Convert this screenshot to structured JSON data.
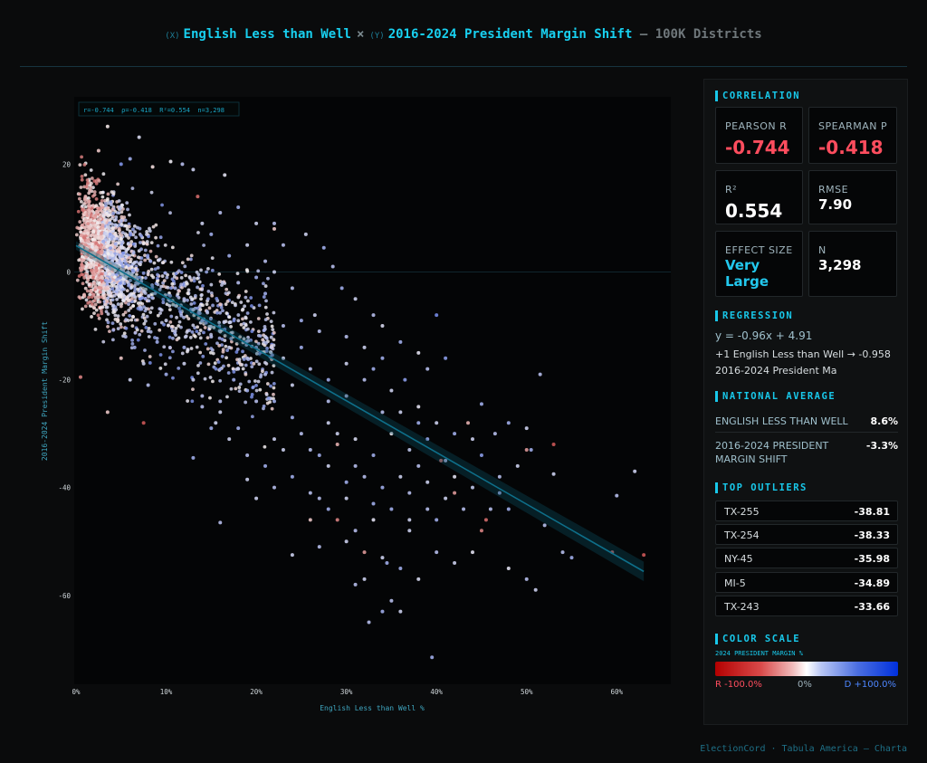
{
  "header": {
    "x_tag": "(X)",
    "x_var": "English Less than Well",
    "times": "×",
    "y_tag": "(Y)",
    "y_var": "2016-2024 President Margin Shift",
    "suffix": "— 100K Districts"
  },
  "chart_data": {
    "type": "scatter",
    "stats_box": "r=-0.744  ρ=-0.418  R²=0.554  n=3,298",
    "xlabel": "English Less than Well %",
    "ylabel": "2016-2024 President Margin Shift",
    "xlim": [
      -0.2,
      66
    ],
    "ylim": [
      -76.5,
      32.5
    ],
    "x_ticks": [
      {
        "v": 0,
        "label": "0%"
      },
      {
        "v": 10,
        "label": "10%"
      },
      {
        "v": 20,
        "label": "20%"
      },
      {
        "v": 30,
        "label": "30%"
      },
      {
        "v": 40,
        "label": "40%"
      },
      {
        "v": 50,
        "label": "50%"
      },
      {
        "v": 60,
        "label": "60%"
      }
    ],
    "y_ticks": [
      {
        "v": 20,
        "label": "20"
      },
      {
        "v": 0,
        "label": "0"
      },
      {
        "v": -20,
        "label": "-20"
      },
      {
        "v": -40,
        "label": "-40"
      },
      {
        "v": -60,
        "label": "-60"
      }
    ],
    "regression": {
      "slope": -0.96,
      "intercept": 4.91,
      "x_range": [
        0,
        63
      ]
    },
    "n": 3298,
    "points": [
      [
        3.5,
        27,
        -5
      ],
      [
        7,
        25,
        15
      ],
      [
        2.5,
        22.5,
        -20
      ],
      [
        10.5,
        20.5,
        5
      ],
      [
        11.8,
        20,
        30
      ],
      [
        13.5,
        14,
        -60
      ],
      [
        16.5,
        18,
        10
      ],
      [
        13,
        19,
        20
      ],
      [
        8.5,
        19.5,
        -10
      ],
      [
        6,
        21,
        40
      ],
      [
        5,
        20,
        55
      ],
      [
        22,
        9,
        30
      ],
      [
        25.5,
        7,
        20
      ],
      [
        27.5,
        4.5,
        40
      ],
      [
        28.5,
        1,
        30
      ],
      [
        29.5,
        -3,
        40
      ],
      [
        31,
        -5,
        20
      ],
      [
        33,
        -8,
        30
      ],
      [
        34,
        -10,
        15
      ],
      [
        36,
        -13,
        40
      ],
      [
        38,
        -15,
        10
      ],
      [
        39,
        -18,
        30
      ],
      [
        41,
        -16,
        50
      ],
      [
        40,
        -8,
        60
      ],
      [
        33,
        -18,
        40
      ],
      [
        35,
        -22,
        20
      ],
      [
        36.5,
        -20,
        50
      ],
      [
        38,
        -25,
        10
      ],
      [
        30,
        -23,
        30
      ],
      [
        28,
        -28,
        20
      ],
      [
        31,
        -31,
        15
      ],
      [
        33,
        -34,
        40
      ],
      [
        35,
        -30,
        5
      ],
      [
        37,
        -33,
        25
      ],
      [
        39,
        -31,
        45
      ],
      [
        41,
        -35,
        30
      ],
      [
        42,
        -38,
        10
      ],
      [
        44,
        -40,
        25
      ],
      [
        46,
        -44,
        30
      ],
      [
        48,
        -44,
        40
      ],
      [
        45,
        -48,
        -50
      ],
      [
        42,
        -41,
        -40
      ],
      [
        40.5,
        -35,
        -60
      ],
      [
        39,
        -39,
        20
      ],
      [
        37,
        -41,
        30
      ],
      [
        35,
        -44,
        40
      ],
      [
        33,
        -46,
        10
      ],
      [
        31,
        -48,
        30
      ],
      [
        29,
        -46,
        -50
      ],
      [
        30,
        -50,
        20
      ],
      [
        32,
        -52,
        -40
      ],
      [
        34,
        -53,
        20
      ],
      [
        36,
        -55,
        40
      ],
      [
        38,
        -57,
        15
      ],
      [
        40,
        -52,
        30
      ],
      [
        42,
        -54,
        20
      ],
      [
        44,
        -52,
        10
      ],
      [
        45.5,
        -46,
        -60
      ],
      [
        48,
        -28,
        40
      ],
      [
        50,
        -29,
        20
      ],
      [
        51.5,
        -19,
        30
      ],
      [
        53,
        -32,
        -70
      ],
      [
        50,
        -33,
        -40
      ],
      [
        50.5,
        -33,
        40
      ],
      [
        53,
        -37.5,
        20
      ],
      [
        54,
        -52,
        30
      ],
      [
        55,
        -53,
        40
      ],
      [
        52,
        -47,
        30
      ],
      [
        51,
        -59,
        20
      ],
      [
        50,
        -57,
        30
      ],
      [
        48,
        -55,
        10
      ],
      [
        43.5,
        -28,
        -30
      ],
      [
        44,
        -31,
        20
      ],
      [
        45,
        -24.5,
        40
      ],
      [
        47,
        -38,
        30
      ],
      [
        45,
        -34,
        50
      ],
      [
        46.5,
        -30,
        30
      ],
      [
        40,
        -46,
        40
      ],
      [
        37,
        -48,
        20
      ],
      [
        35,
        -61,
        30
      ],
      [
        36,
        -63,
        20
      ],
      [
        34,
        -63,
        40
      ],
      [
        32.5,
        -65,
        30
      ],
      [
        39.5,
        -71.5,
        40
      ],
      [
        60,
        -41.5,
        30
      ],
      [
        62,
        -37,
        20
      ],
      [
        59.5,
        -52,
        -60
      ],
      [
        63,
        -52.5,
        -70
      ],
      [
        16,
        -46.5,
        30
      ],
      [
        19,
        -38.5,
        20
      ],
      [
        13,
        -34.5,
        40
      ],
      [
        31,
        -58,
        30
      ],
      [
        32,
        -57,
        20
      ],
      [
        34.5,
        -54,
        40
      ],
      [
        27,
        -51,
        30
      ],
      [
        24,
        -52.5,
        20
      ],
      [
        26,
        -46,
        -20
      ],
      [
        12,
        -17,
        20
      ],
      [
        14,
        -23,
        30
      ],
      [
        16,
        -26,
        20
      ],
      [
        18,
        -29,
        40
      ],
      [
        20,
        -24,
        30
      ],
      [
        22,
        -31,
        20
      ],
      [
        24,
        -27,
        40
      ],
      [
        26,
        -33,
        30
      ],
      [
        28,
        -36,
        20
      ],
      [
        30,
        -39,
        40
      ],
      [
        22,
        -40,
        30
      ],
      [
        20,
        -42,
        20
      ],
      [
        24,
        -38,
        40
      ],
      [
        27,
        -42,
        30
      ],
      [
        29,
        -32,
        -30
      ],
      [
        0.5,
        -19.5,
        -50
      ],
      [
        7.5,
        -28,
        -70
      ],
      [
        3.5,
        -26,
        -20
      ],
      [
        15.5,
        -28,
        20
      ],
      [
        16,
        -24,
        30
      ],
      [
        17.5,
        -20,
        40
      ],
      [
        18,
        -18,
        20
      ],
      [
        19,
        -16,
        30
      ],
      [
        20,
        -14,
        40
      ],
      [
        21,
        -12,
        20
      ],
      [
        23,
        -10,
        30
      ],
      [
        25,
        -9,
        40
      ],
      [
        26.5,
        -8,
        20
      ],
      [
        27,
        -11,
        30
      ],
      [
        25,
        -14,
        40
      ],
      [
        23,
        -16,
        20
      ],
      [
        21,
        -19,
        30
      ],
      [
        19,
        -22,
        40
      ],
      [
        17,
        -14,
        20
      ],
      [
        15,
        -12,
        30
      ],
      [
        14,
        -9,
        40
      ],
      [
        13,
        -7,
        20
      ],
      [
        12,
        -5,
        30
      ],
      [
        11,
        -3,
        40
      ],
      [
        16,
        -6,
        -20
      ],
      [
        18,
        -2,
        30
      ],
      [
        20,
        -1,
        40
      ],
      [
        22,
        0,
        20
      ],
      [
        24,
        -3,
        30
      ],
      [
        17,
        3,
        40
      ],
      [
        19,
        5,
        20
      ],
      [
        21,
        2,
        30
      ],
      [
        15,
        7,
        40
      ],
      [
        14,
        9,
        20
      ],
      [
        16,
        11,
        30
      ],
      [
        18,
        12,
        40
      ],
      [
        20,
        9,
        20
      ],
      [
        23,
        5,
        30
      ],
      [
        22,
        8,
        -20
      ],
      [
        21,
        -4,
        40
      ],
      [
        30,
        -12,
        30
      ],
      [
        32,
        -14,
        20
      ],
      [
        34,
        -16,
        40
      ],
      [
        32,
        -20,
        30
      ],
      [
        30,
        -17,
        20
      ],
      [
        28,
        -20,
        40
      ],
      [
        26,
        -18,
        30
      ],
      [
        24,
        -21,
        20
      ],
      [
        22,
        -24,
        40
      ],
      [
        28,
        -24,
        30
      ],
      [
        36,
        -26,
        20
      ],
      [
        38,
        -28,
        40
      ],
      [
        34,
        -26,
        30
      ],
      [
        40,
        -28,
        20
      ],
      [
        42,
        -30,
        40
      ],
      [
        38,
        -36,
        30
      ],
      [
        36,
        -38,
        20
      ],
      [
        34,
        -40,
        40
      ],
      [
        32,
        -38,
        30
      ],
      [
        30,
        -42,
        20
      ],
      [
        28,
        -44,
        40
      ],
      [
        26,
        -41,
        30
      ],
      [
        41,
        -42,
        20
      ],
      [
        43,
        -44,
        30
      ],
      [
        47,
        -41,
        40
      ],
      [
        49,
        -36,
        20
      ],
      [
        39,
        -44,
        30
      ],
      [
        37,
        -46,
        20
      ],
      [
        33,
        -43,
        40
      ],
      [
        31,
        -36,
        30
      ],
      [
        29,
        -30,
        20
      ],
      [
        27,
        -34,
        40
      ],
      [
        25,
        -30,
        30
      ],
      [
        23,
        -33,
        20
      ],
      [
        21,
        -36,
        40
      ],
      [
        19,
        -34,
        30
      ],
      [
        17,
        -31,
        20
      ],
      [
        15,
        -29,
        40
      ],
      [
        14,
        -25,
        30
      ],
      [
        13,
        -20,
        20
      ],
      [
        12,
        -14,
        40
      ],
      [
        11,
        -11,
        30
      ],
      [
        10,
        -9,
        20
      ],
      [
        9,
        -13,
        40
      ],
      [
        8,
        -11,
        30
      ],
      [
        7.5,
        -17,
        20
      ],
      [
        6.5,
        -14,
        40
      ],
      [
        5.5,
        -12,
        30
      ],
      [
        5,
        -16,
        -20
      ],
      [
        6,
        -20,
        20
      ],
      [
        8,
        -21,
        30
      ],
      [
        10,
        -19,
        40
      ]
    ]
  },
  "panel": {
    "correlation": {
      "title": "CORRELATION",
      "pearson_label": "PEARSON R",
      "pearson_value": "-0.744",
      "spearman_label": "SPEARMAN P",
      "spearman_value": "-0.418",
      "r2_label": "R²",
      "r2_value": "0.554",
      "rmse_label": "RMSE",
      "rmse_value": "7.90",
      "effect_label": "EFFECT SIZE",
      "effect_value_1": "Very",
      "effect_value_2": "Large",
      "n_label": "N",
      "n_value": "3,298"
    },
    "regression": {
      "title": "REGRESSION",
      "equation": "y = -0.96x + 4.91",
      "interp_1": "+1 English Less than Well → -0.958",
      "interp_2": "2016-2024 President Ma"
    },
    "national": {
      "title": "NATIONAL AVERAGE",
      "row1_label": "ENGLISH LESS THAN WELL",
      "row1_value": "8.6%",
      "row2_label_1": "2016-2024 PRESIDENT",
      "row2_label_2": "MARGIN SHIFT",
      "row2_value": "-3.3%"
    },
    "outliers": {
      "title": "TOP OUTLIERS",
      "items": [
        {
          "name": "TX-255",
          "value": "-38.81"
        },
        {
          "name": "TX-254",
          "value": "-38.33"
        },
        {
          "name": "NY-45",
          "value": "-35.98"
        },
        {
          "name": "MI-5",
          "value": "-34.89"
        },
        {
          "name": "TX-243",
          "value": "-33.66"
        }
      ]
    },
    "color_scale": {
      "title": "COLOR SCALE",
      "subtitle": "2024 PRESIDENT MARGIN %",
      "left": "R -100.0%",
      "mid": "0%",
      "right": "D +100.0%"
    }
  },
  "colors": {
    "accent": "#18c8ea",
    "negative": "#ff4d5e",
    "republican": "#b30000",
    "democrat": "#0030dd",
    "regression_line": "#0e6f8a"
  },
  "footer": "ElectionCord · Tabula America — Charta"
}
